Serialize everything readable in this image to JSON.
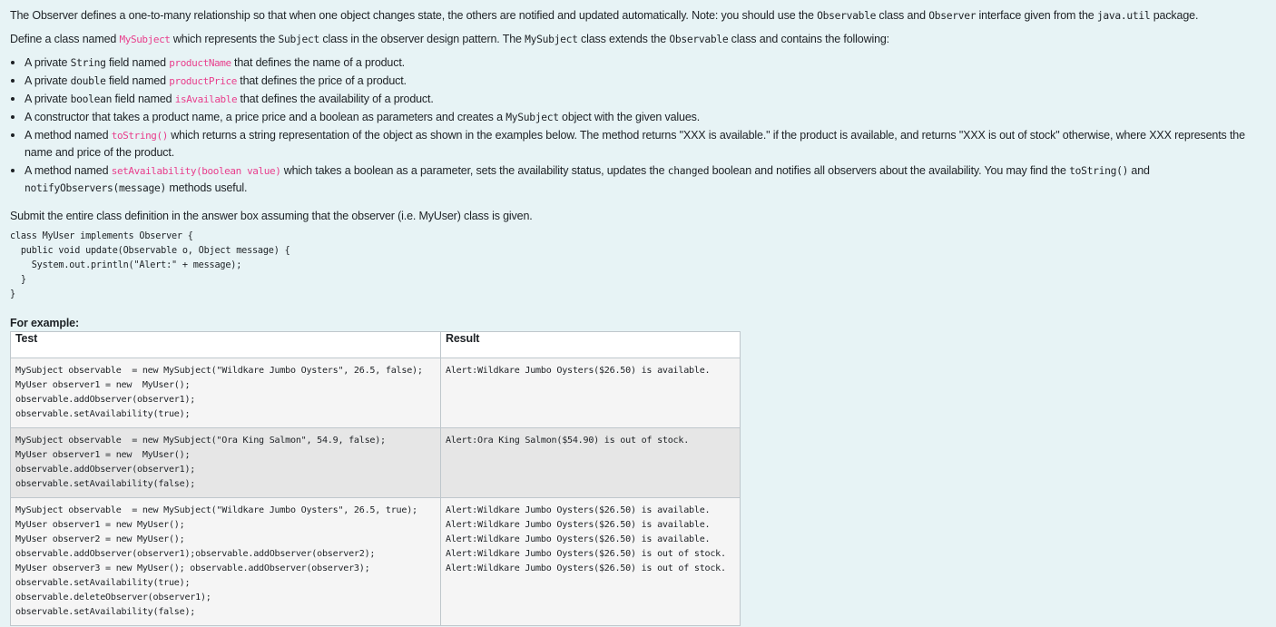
{
  "intro": {
    "p1_a": "The Observer defines a one-to-many relationship so that when one object changes state, the others are notified and updated automatically. Note: you should use the ",
    "p1_code1": "Observable",
    "p1_b": " class and ",
    "p1_code2": "Observer",
    "p1_c": " interface given from the ",
    "p1_code3": "java.util",
    "p1_d": " package.",
    "p2_a": "Define a class named ",
    "p2_pink": "MySubject",
    "p2_b": " which represents the ",
    "p2_code1": "Subject",
    "p2_c": " class in the observer design pattern. The ",
    "p2_code2": "MySubject",
    "p2_d": " class extends the ",
    "p2_code3": "Observable",
    "p2_e": " class and contains the following:"
  },
  "bullets": [
    {
      "a": "A private ",
      "code": "String",
      "b": " field named ",
      "pink": "productName",
      "c": " that defines the name of a product."
    },
    {
      "a": "A private ",
      "code": "double",
      "b": " field named ",
      "pink": "productPrice",
      "c": " that defines the price of a product."
    },
    {
      "a": "A private ",
      "code": "boolean",
      "b": " field named ",
      "pink": "isAvailable",
      "c": " that defines the availability of a product."
    },
    {
      "a": "A constructor that takes a product name, a price price and a boolean as parameters and creates a ",
      "code": "MySubject",
      "b": " object with the given values."
    },
    {
      "a": "A method named ",
      "pink": "toString()",
      "b": " which returns a string representation of the object as shown in the examples below. The method returns \"XXX is available.\" if the product is available, and returns \"XXX is out of stock\" otherwise, where XXX represents the name and price of the product."
    },
    {
      "a": "A method named ",
      "pink": "setAvailability(boolean value)",
      "b": " which takes a boolean as a parameter, sets the availability status, updates the ",
      "code": "changed",
      "c": " boolean and notifies all observers about the availability. You may find the ",
      "code2": "toString()",
      "d": " and ",
      "code3": "notifyObservers(message)",
      "e": " methods useful."
    }
  ],
  "submit_text": "Submit the entire class definition in the answer box assuming that the observer (i.e. MyUser) class is given.",
  "given_code": "class MyUser implements Observer {\n  public void update(Observable o, Object message) {\n    System.out.println(\"Alert:\" + message);\n  }\n}",
  "for_example": "For example:",
  "table": {
    "headers": [
      "Test",
      "Result"
    ],
    "rows": [
      {
        "test": "MySubject observable  = new MySubject(\"Wildkare Jumbo Oysters\", 26.5, false);\nMyUser observer1 = new  MyUser();\nobservable.addObserver(observer1);\nobservable.setAvailability(true);",
        "result": "Alert:Wildkare Jumbo Oysters($26.50) is available."
      },
      {
        "test": "MySubject observable  = new MySubject(\"Ora King Salmon\", 54.9, false);\nMyUser observer1 = new  MyUser();\nobservable.addObserver(observer1);\nobservable.setAvailability(false);",
        "result": "Alert:Ora King Salmon($54.90) is out of stock."
      },
      {
        "test": "MySubject observable  = new MySubject(\"Wildkare Jumbo Oysters\", 26.5, true);\nMyUser observer1 = new MyUser();\nMyUser observer2 = new MyUser();\nobservable.addObserver(observer1);observable.addObserver(observer2);\nMyUser observer3 = new MyUser(); observable.addObserver(observer3);\nobservable.setAvailability(true);\nobservable.deleteObserver(observer1);\nobservable.setAvailability(false);",
        "result": "Alert:Wildkare Jumbo Oysters($26.50) is available.\nAlert:Wildkare Jumbo Oysters($26.50) is available.\nAlert:Wildkare Jumbo Oysters($26.50) is available.\nAlert:Wildkare Jumbo Oysters($26.50) is out of stock.\nAlert:Wildkare Jumbo Oysters($26.50) is out of stock."
      }
    ]
  }
}
